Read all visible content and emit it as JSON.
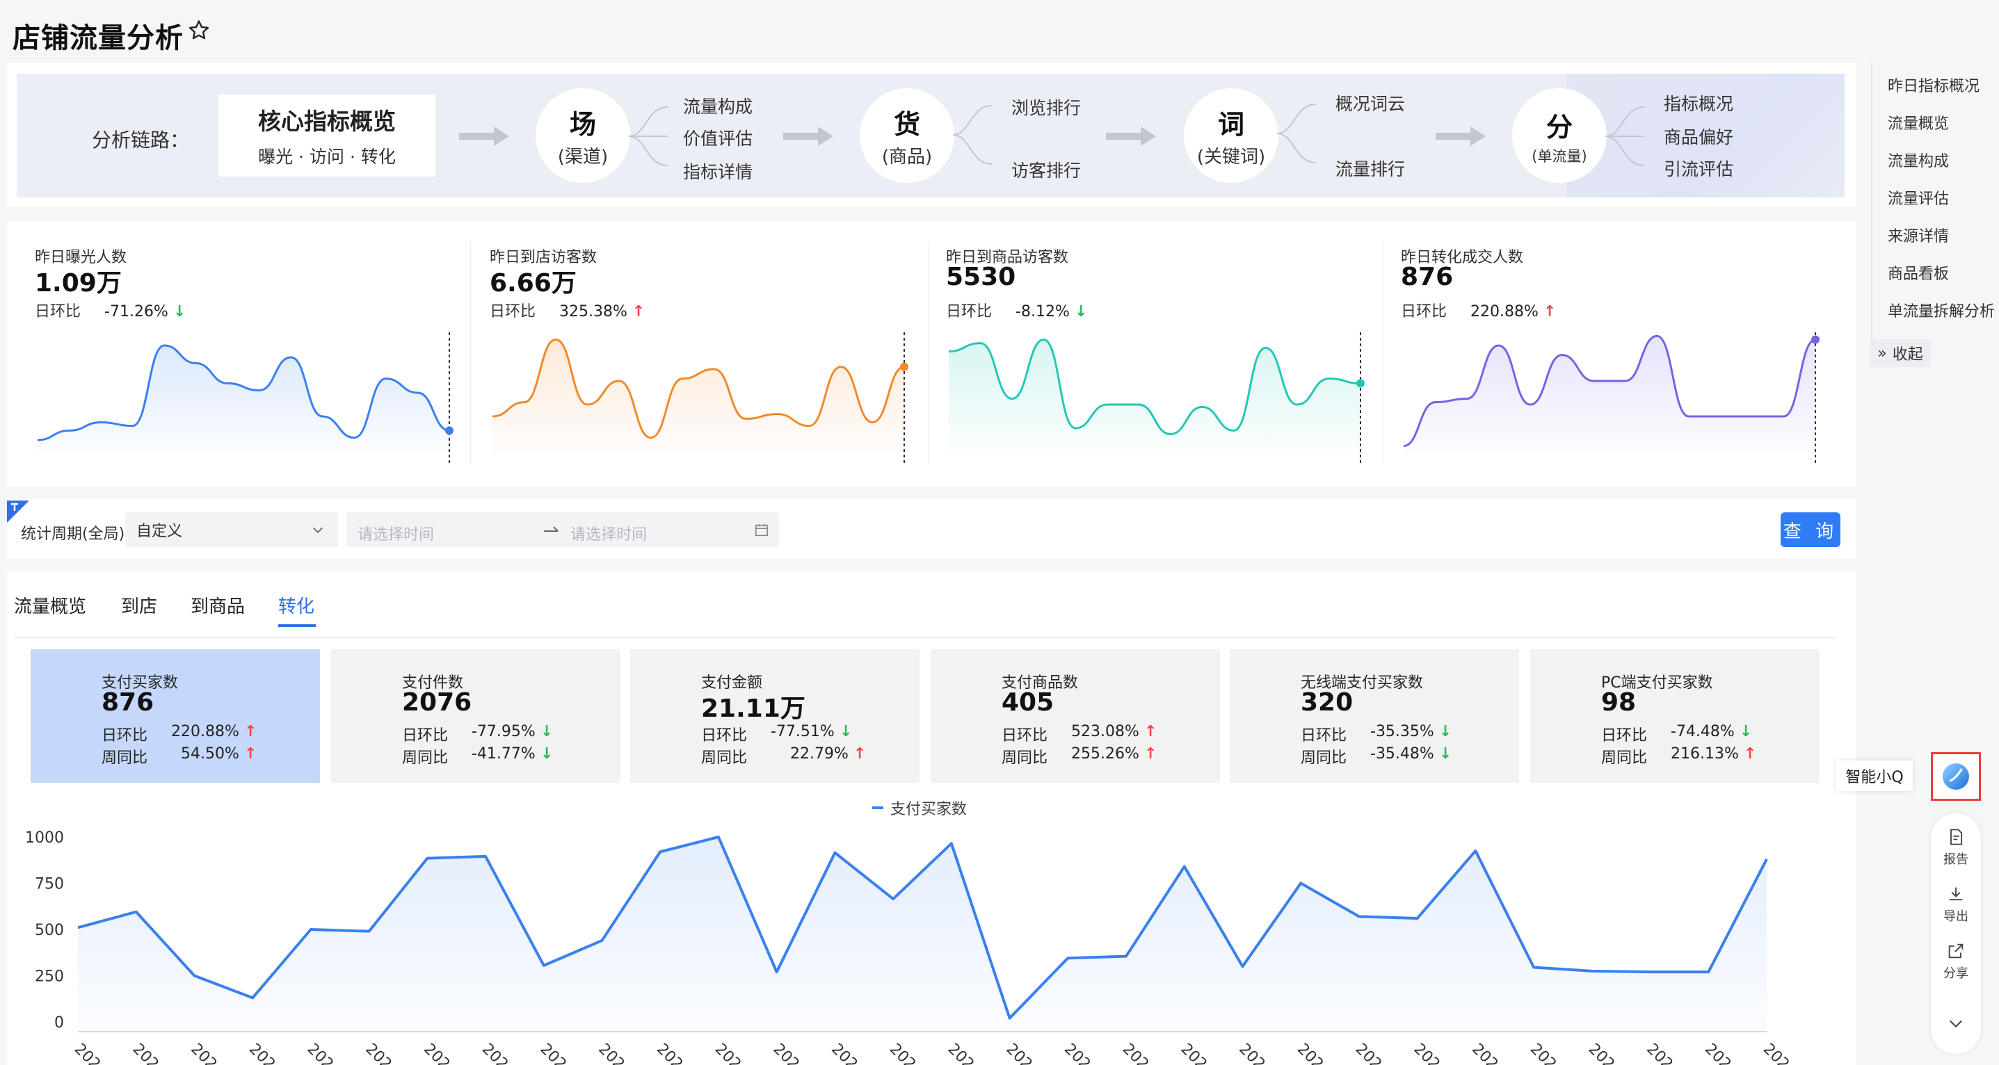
{
  "page": {
    "title": "店铺流量分析"
  },
  "chain": {
    "label": "分析链路：",
    "core_title": "核心指标概览",
    "core_sub": "曝光 · 访问 · 转化",
    "nodes": [
      {
        "big": "场",
        "sub": "(渠道)",
        "branches": [
          "流量构成",
          "价值评估",
          "指标详情"
        ]
      },
      {
        "big": "货",
        "sub": "(商品)",
        "branches": [
          "浏览排行",
          "访客排行"
        ]
      },
      {
        "big": "词",
        "sub": "(关键词)",
        "branches": [
          "概况词云",
          "流量排行"
        ]
      },
      {
        "big": "分",
        "sub": "(单流量)",
        "branches": [
          "指标概况",
          "商品偏好",
          "引流评估"
        ]
      }
    ]
  },
  "metrics": [
    {
      "label": "昨日曝光人数",
      "value": "1.09万",
      "ratio_label": "日环比",
      "ratio": "-71.26%",
      "dir": "down",
      "color": "#3a80ee",
      "trend": [
        0.1,
        0.18,
        0.25,
        0.22,
        0.9,
        0.75,
        0.58,
        0.52,
        0.8,
        0.3,
        0.12,
        0.62,
        0.5,
        0.18
      ]
    },
    {
      "label": "昨日到店访客数",
      "value": "6.66万",
      "ratio_label": "日环比",
      "ratio": "325.38%",
      "dir": "up",
      "color": "#f08a2a",
      "trend": [
        0.3,
        0.42,
        0.95,
        0.4,
        0.6,
        0.12,
        0.62,
        0.7,
        0.28,
        0.32,
        0.22,
        0.72,
        0.25,
        0.72
      ]
    },
    {
      "label": "昨日到商品访客数",
      "value": "5530",
      "ratio_label": "日环比",
      "ratio": "-8.12%",
      "dir": "down",
      "color": "#24c7b5",
      "trend": [
        0.85,
        0.92,
        0.45,
        0.95,
        0.2,
        0.4,
        0.4,
        0.15,
        0.38,
        0.18,
        0.88,
        0.4,
        0.62,
        0.58
      ]
    },
    {
      "label": "昨日转化成交人数",
      "value": "876",
      "ratio_label": "日环比",
      "ratio": "220.88%",
      "dir": "up",
      "color": "#7165e3",
      "trend": [
        0.05,
        0.42,
        0.45,
        0.9,
        0.4,
        0.82,
        0.6,
        0.6,
        0.98,
        0.3,
        0.3,
        0.3,
        0.3,
        0.95
      ]
    }
  ],
  "right_nav": {
    "items": [
      "昨日指标概况",
      "流量概览",
      "流量构成",
      "流量评估",
      "来源详情",
      "商品看板",
      "单流量拆解分析"
    ],
    "collapse": "收起"
  },
  "filter": {
    "label": "统计周期(全局)",
    "select_value": "自定义",
    "start_placeholder": "请选择时间",
    "end_placeholder": "请选择时间",
    "query": "查 询"
  },
  "tabs": [
    {
      "label": "流量概览",
      "active": false
    },
    {
      "label": "到店",
      "active": false
    },
    {
      "label": "到商品",
      "active": false
    },
    {
      "label": "转化",
      "active": true
    }
  ],
  "kpis": [
    {
      "label": "支付买家数",
      "value": "876",
      "day_label": "日环比",
      "day": "220.88%",
      "day_dir": "up",
      "week_label": "周同比",
      "week": "54.50%",
      "week_dir": "up",
      "selected": true
    },
    {
      "label": "支付件数",
      "value": "2076",
      "day_label": "日环比",
      "day": "-77.95%",
      "day_dir": "down",
      "week_label": "周同比",
      "week": "-41.77%",
      "week_dir": "down",
      "selected": false
    },
    {
      "label": "支付金额",
      "value": "21.11万",
      "day_label": "日环比",
      "day": "-77.51%",
      "day_dir": "down",
      "week_label": "周同比",
      "week": "22.79%",
      "week_dir": "up",
      "selected": false
    },
    {
      "label": "支付商品数",
      "value": "405",
      "day_label": "日环比",
      "day": "523.08%",
      "day_dir": "up",
      "week_label": "周同比",
      "week": "255.26%",
      "week_dir": "up",
      "selected": false
    },
    {
      "label": "无线端支付买家数",
      "value": "320",
      "day_label": "日环比",
      "day": "-35.35%",
      "day_dir": "down",
      "week_label": "周同比",
      "week": "-35.48%",
      "week_dir": "down",
      "selected": false
    },
    {
      "label": "PC端支付买家数",
      "value": "98",
      "day_label": "日环比",
      "day": "-74.48%",
      "day_dir": "down",
      "week_label": "周同比",
      "week": "216.13%",
      "week_dir": "up",
      "selected": false
    }
  ],
  "chart_data": {
    "type": "area",
    "series": [
      {
        "name": "支付买家数",
        "values": [
          510,
          595,
          250,
          130,
          500,
          490,
          885,
          895,
          305,
          440,
          920,
          1000,
          270,
          915,
          665,
          965,
          20,
          345,
          355,
          840,
          300,
          750,
          570,
          560,
          925,
          295,
          275,
          270,
          270,
          880
        ]
      }
    ],
    "ylim": [
      0,
      1000
    ],
    "yticks": [
      "1000",
      "750",
      "500",
      "250",
      "0"
    ],
    "x_tick_prefix": "202",
    "color": "#3a80ee",
    "grid": false
  },
  "floats": {
    "assistant": "智能小Q",
    "tools": [
      "报告",
      "导出",
      "分享"
    ]
  }
}
